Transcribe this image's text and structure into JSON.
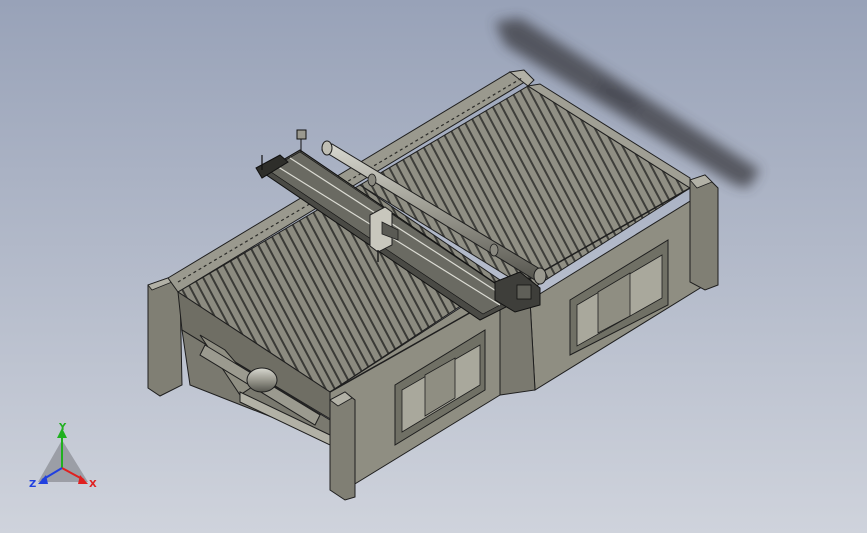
{
  "viewport": {
    "background_top": "#98a2b8",
    "background_bottom": "#cfd3dc"
  },
  "model": {
    "body_color": "#8f8e82",
    "body_dark": "#6f6e64",
    "body_light": "#b2b1a6",
    "edge_color": "#1e1e1e",
    "window_color": "#a9a89c"
  },
  "triad": {
    "x_label": "X",
    "y_label": "Y",
    "z_label": "Z",
    "x_color": "#e02020",
    "y_color": "#20b020",
    "z_color": "#2040e0"
  }
}
